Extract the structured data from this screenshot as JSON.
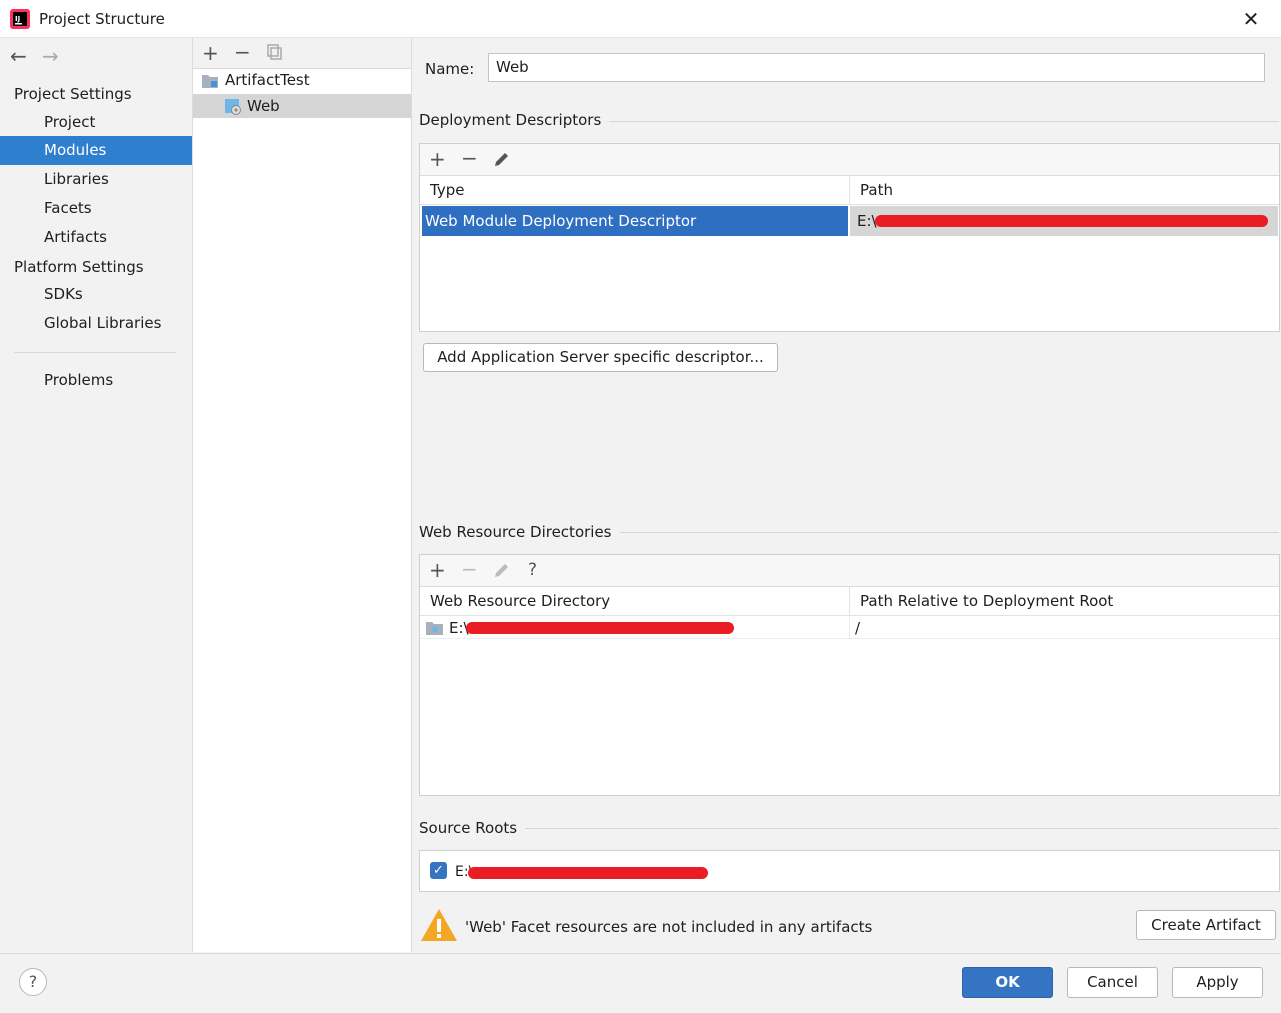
{
  "window": {
    "title": "Project Structure"
  },
  "nav": {
    "project_settings_header": "Project Settings",
    "items": [
      "Project",
      "Modules",
      "Libraries",
      "Facets",
      "Artifacts"
    ],
    "platform_settings_header": "Platform Settings",
    "platform_items": [
      "SDKs",
      "Global Libraries"
    ],
    "problems": "Problems",
    "selected": "Modules"
  },
  "tree": {
    "items": [
      {
        "label": "ArtifactTest",
        "icon": "module-folder-icon"
      },
      {
        "label": "Web",
        "icon": "web-facet-icon"
      }
    ],
    "selected": "Web"
  },
  "facet": {
    "name_label": "Name:",
    "name_value": "Web",
    "deployment_descriptors": {
      "title": "Deployment Descriptors",
      "columns": [
        "Type",
        "Path"
      ],
      "rows": [
        {
          "type": "Web Module Deployment Descriptor",
          "path": "E:\\"
        }
      ],
      "add_server_descriptor_button": "Add Application Server specific descriptor..."
    },
    "web_resource_directories": {
      "title": "Web Resource Directories",
      "columns": [
        "Web Resource Directory",
        "Path Relative to Deployment Root"
      ],
      "rows": [
        {
          "directory": "E:\\",
          "relative_path": "/"
        }
      ]
    },
    "source_roots": {
      "title": "Source Roots",
      "items": [
        {
          "path": "E:\\",
          "checked": true
        }
      ]
    },
    "warning": {
      "text": "'Web' Facet resources are not included in any artifacts",
      "button": "Create Artifact"
    }
  },
  "footer": {
    "help": "?",
    "ok": "OK",
    "cancel": "Cancel",
    "apply": "Apply"
  },
  "colors": {
    "selection": "#2f7fcf",
    "primary_button": "#3574c2",
    "redaction": "#ea1c24",
    "warning": "#f5a623"
  }
}
